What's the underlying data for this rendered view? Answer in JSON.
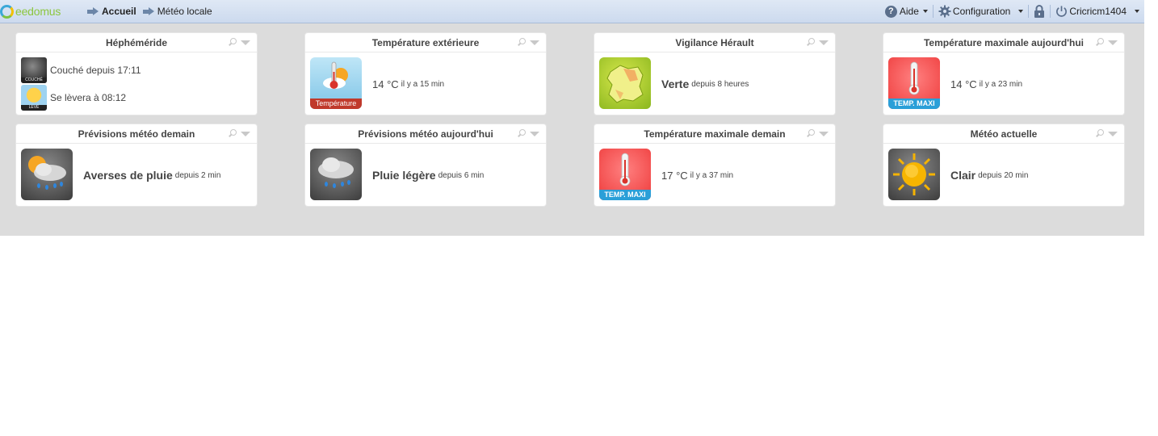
{
  "topbar": {
    "logo_text": "eedomus",
    "nav": [
      {
        "label": "Accueil"
      },
      {
        "label": "Météo locale"
      }
    ],
    "help_label": "Aide",
    "config_label": "Configuration",
    "user_label": "Cricricm1404"
  },
  "widgets": {
    "ephemeride": {
      "title": "Héphéméride",
      "set_caption": "COUCHÉ",
      "rise_caption": "LEVÉ",
      "line1": "Couché depuis 17:11",
      "line2": "Se lèvera à 08:12"
    },
    "temp_ext": {
      "title": "Température extérieure",
      "value": "14 °C",
      "since": "il y a 15 min",
      "tile_label": "Température"
    },
    "vigilance": {
      "title": "Vigilance Hérault",
      "value": "Verte",
      "since": "depuis 8 heures"
    },
    "temp_max_today": {
      "title": "Température maximale aujourd'hui",
      "value": "14 °C",
      "since": "il y a 23 min",
      "tile_label": "TEMP. MAXI"
    },
    "prev_demain": {
      "title": "Prévisions météo demain",
      "value": "Averses de pluie",
      "since": "depuis 2 min"
    },
    "prev_auj": {
      "title": "Prévisions météo aujourd'hui",
      "value": "Pluie légère",
      "since": "depuis 6 min"
    },
    "temp_max_demain": {
      "title": "Température maximale demain",
      "value": "17 °C",
      "since": "il y a 37 min",
      "tile_label": "TEMP. MAXI"
    },
    "meteo_actuelle": {
      "title": "Météo actuelle",
      "value": "Clair",
      "since": "depuis 20 min"
    }
  }
}
